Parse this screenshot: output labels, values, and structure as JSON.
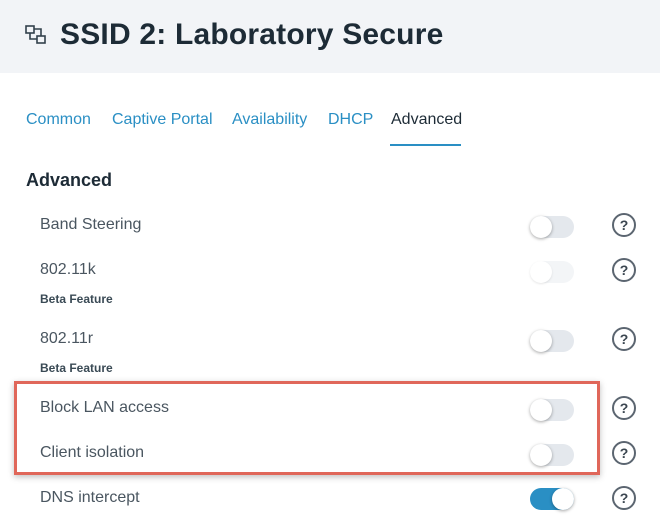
{
  "header": {
    "title": "SSID 2: Laboratory Secure",
    "icon": "ssid-network-icon"
  },
  "tabs": [
    {
      "label": "Common",
      "active": false
    },
    {
      "label": "Captive Portal",
      "active": false
    },
    {
      "label": "Availability",
      "active": false
    },
    {
      "label": "DHCP",
      "active": false
    },
    {
      "label": "Advanced",
      "active": true
    }
  ],
  "section": {
    "title": "Advanced"
  },
  "settings": [
    {
      "label": "Band Steering",
      "sublabel": "",
      "state": "off",
      "help": "?"
    },
    {
      "label": "802.11k",
      "sublabel": "Beta Feature",
      "state": "disabled",
      "help": "?"
    },
    {
      "label": "802.11r",
      "sublabel": "Beta Feature",
      "state": "off",
      "help": "?"
    },
    {
      "label": "Block LAN access",
      "sublabel": "",
      "state": "off",
      "help": "?"
    },
    {
      "label": "Client isolation",
      "sublabel": "",
      "state": "off",
      "help": "?"
    },
    {
      "label": "DNS intercept",
      "sublabel": "",
      "state": "on",
      "help": "?"
    }
  ],
  "colors": {
    "accent": "#2a8fc4",
    "highlight_border": "#e0675a",
    "header_bg": "#f2f4f7"
  }
}
